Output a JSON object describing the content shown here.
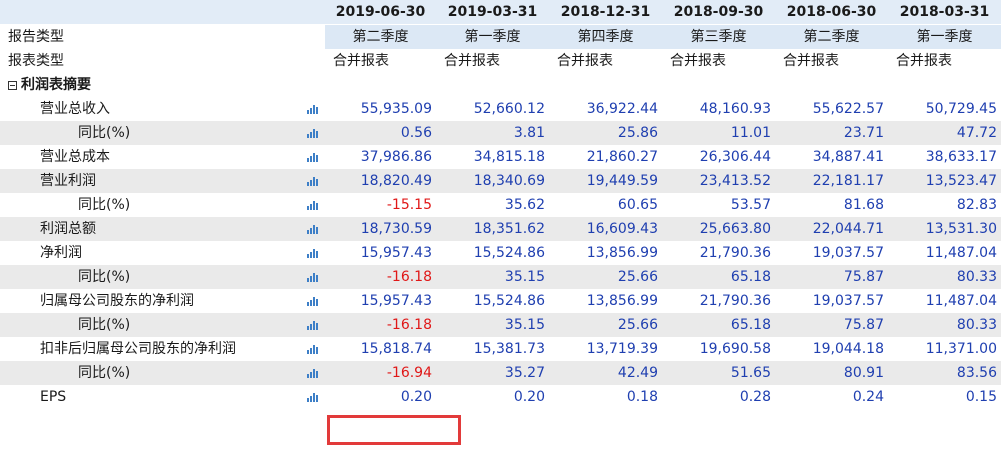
{
  "columns": [
    "2019-06-30",
    "2019-03-31",
    "2018-12-31",
    "2018-09-30",
    "2018-06-30",
    "2018-03-31"
  ],
  "report_type": {
    "label": "报告类型",
    "values": [
      "第二季度",
      "第一季度",
      "第四季度",
      "第三季度",
      "第二季度",
      "第一季度"
    ]
  },
  "statement_type": {
    "label": "报表类型",
    "values": [
      "合并报表",
      "合并报表",
      "合并报表",
      "合并报表",
      "合并报表",
      "合并报表"
    ]
  },
  "section_label": "利润表摘要",
  "rows": [
    {
      "label": "营业总收入",
      "values": [
        "55,935.09",
        "52,660.12",
        "36,922.44",
        "48,160.93",
        "55,622.57",
        "50,729.45"
      ]
    },
    {
      "label": "同比(%)",
      "values": [
        "0.56",
        "3.81",
        "25.86",
        "11.01",
        "23.71",
        "47.72"
      ]
    },
    {
      "label": "营业总成本",
      "values": [
        "37,986.86",
        "34,815.18",
        "21,860.27",
        "26,306.44",
        "34,887.41",
        "38,633.17"
      ]
    },
    {
      "label": "营业利润",
      "values": [
        "18,820.49",
        "18,340.69",
        "19,449.59",
        "23,413.52",
        "22,181.17",
        "13,523.47"
      ]
    },
    {
      "label": "同比(%)",
      "values": [
        "-15.15",
        "35.62",
        "60.65",
        "53.57",
        "81.68",
        "82.83"
      ]
    },
    {
      "label": "利润总额",
      "values": [
        "18,730.59",
        "18,351.62",
        "16,609.43",
        "25,663.80",
        "22,044.71",
        "13,531.30"
      ]
    },
    {
      "label": "净利润",
      "values": [
        "15,957.43",
        "15,524.86",
        "13,856.99",
        "21,790.36",
        "19,037.57",
        "11,487.04"
      ]
    },
    {
      "label": "同比(%)",
      "values": [
        "-16.18",
        "35.15",
        "25.66",
        "65.18",
        "75.87",
        "80.33"
      ]
    },
    {
      "label": "归属母公司股东的净利润",
      "values": [
        "15,957.43",
        "15,524.86",
        "13,856.99",
        "21,790.36",
        "19,037.57",
        "11,487.04"
      ]
    },
    {
      "label": "同比(%)",
      "values": [
        "-16.18",
        "35.15",
        "25.66",
        "65.18",
        "75.87",
        "80.33"
      ]
    },
    {
      "label": "扣非后归属母公司股东的净利润",
      "values": [
        "15,818.74",
        "15,381.73",
        "13,719.39",
        "19,690.58",
        "19,044.18",
        "11,371.00"
      ]
    },
    {
      "label": "同比(%)",
      "values": [
        "-16.94",
        "35.27",
        "42.49",
        "51.65",
        "80.91",
        "83.56"
      ]
    },
    {
      "label": "EPS",
      "values": [
        "0.20",
        "0.20",
        "0.18",
        "0.28",
        "0.24",
        "0.15"
      ]
    }
  ],
  "icons": {
    "row_chart": "bar-chart-icon",
    "section_toggle": "collapse-icon"
  },
  "colors": {
    "number": "#1f3fb0",
    "negative": "#e01818",
    "header_bg": "#e2ecf7",
    "alt_row": "#eaeaea",
    "highlight": "#e23a3a"
  }
}
